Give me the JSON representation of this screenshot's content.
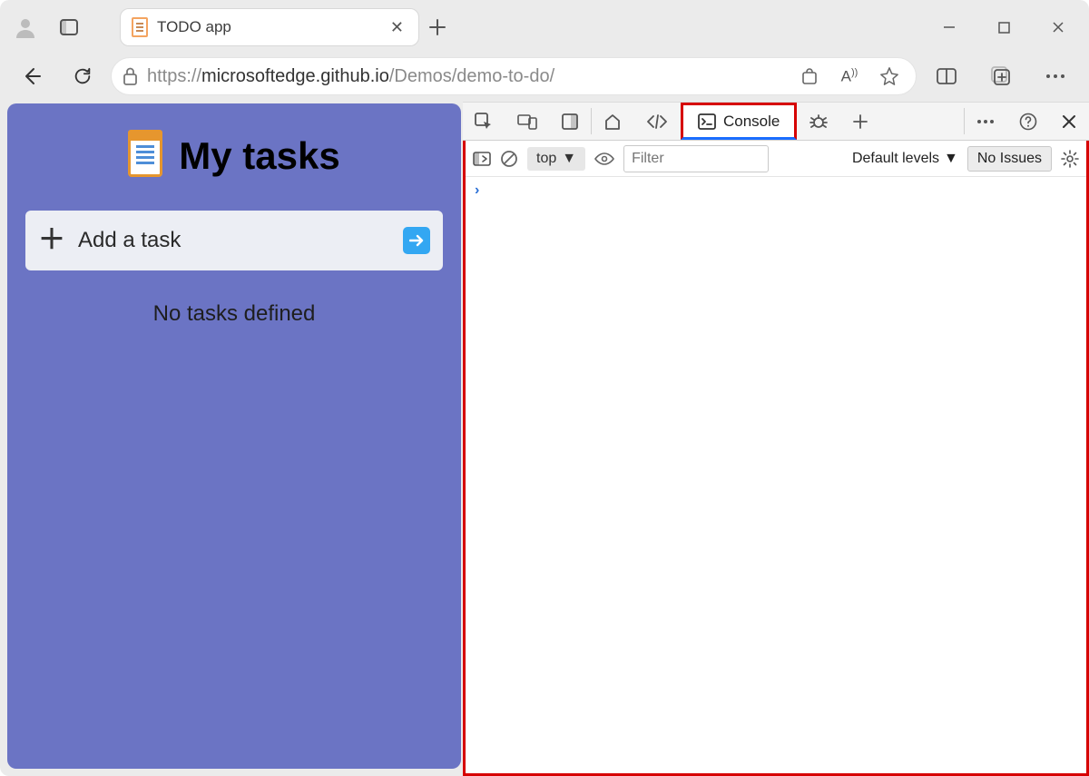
{
  "browser": {
    "tab_title": "TODO app",
    "url_prefix": "https://",
    "url_host": "microsoftedge.github.io",
    "url_path": "/Demos/demo-to-do/"
  },
  "page": {
    "heading": "My tasks",
    "add_task_placeholder": "Add a task",
    "empty_message": "No tasks defined"
  },
  "devtools": {
    "tabs": {
      "console": "Console"
    },
    "toolbar": {
      "context": "top",
      "filter_placeholder": "Filter",
      "levels_label": "Default levels",
      "issues_button": "No Issues"
    }
  }
}
